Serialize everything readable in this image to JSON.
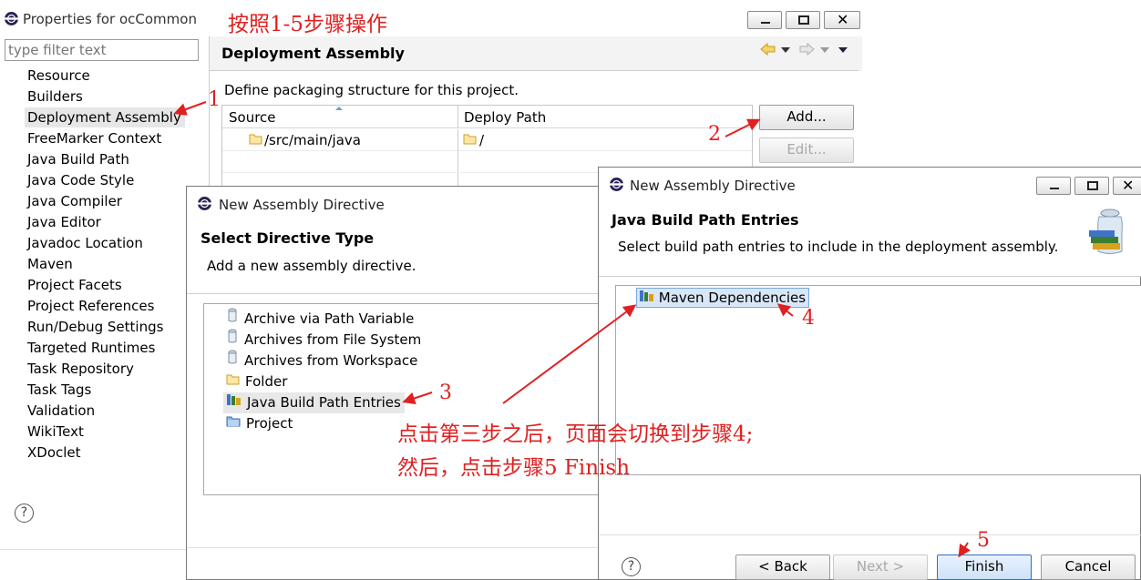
{
  "properties": {
    "title": "Properties for ocCommon",
    "filter_placeholder": "type filter text",
    "nav_items": [
      "Resource",
      "Builders",
      "Deployment Assembly",
      "FreeMarker Context",
      "Java Build Path",
      "Java Code Style",
      "Java Compiler",
      "Java Editor",
      "Javadoc Location",
      "Maven",
      "Project Facets",
      "Project References",
      "Run/Debug Settings",
      "Targeted Runtimes",
      "Task Repository",
      "Task Tags",
      "Validation",
      "WikiText",
      "XDoclet"
    ],
    "page_title": "Deployment Assembly",
    "description": "Define packaging structure for this project.",
    "col_source": "Source",
    "col_deploy": "Deploy Path",
    "row_source": "/src/main/java",
    "row_deploy": "/",
    "add_label": "Add...",
    "edit_label": "Edit...",
    "help": "?"
  },
  "dialog1": {
    "title": "New Assembly Directive",
    "heading": "Select Directive Type",
    "subheading": "Add a new assembly directive.",
    "items": [
      "Archive via Path Variable",
      "Archives from File System",
      "Archives from Workspace",
      "Folder",
      "Java Build Path Entries",
      "Project"
    ]
  },
  "dialog2": {
    "title": "New Assembly Directive",
    "heading": "Java Build Path Entries",
    "subheading": "Select build path entries to include in the deployment assembly.",
    "entry": "Maven Dependencies",
    "help": "?",
    "back_label": "< Back",
    "next_label": "Next >",
    "finish_label": "Finish",
    "cancel_label": "Cancel"
  },
  "annotations": {
    "header": "按照1-5步骤操作",
    "step1": "1",
    "step2": "2",
    "step3": "3",
    "step4": "4",
    "step5": "5",
    "note_line1": "点击第三步之后，页面会切换到步骤4;",
    "note_line2": "然后，点击步骤5 Finish"
  },
  "colors": {
    "annotation": "#e02020",
    "selection": "#d8e6f7",
    "focus": "#2f6fc9"
  },
  "icons": [
    "eclipse-icon",
    "minimize-icon",
    "maximize-icon",
    "close-icon",
    "back-arrow-icon",
    "forward-arrow-icon",
    "menu-down-icon",
    "folder-icon",
    "jar-icon",
    "library-icon",
    "project-icon",
    "help-icon",
    "wizard-jar-icon"
  ]
}
